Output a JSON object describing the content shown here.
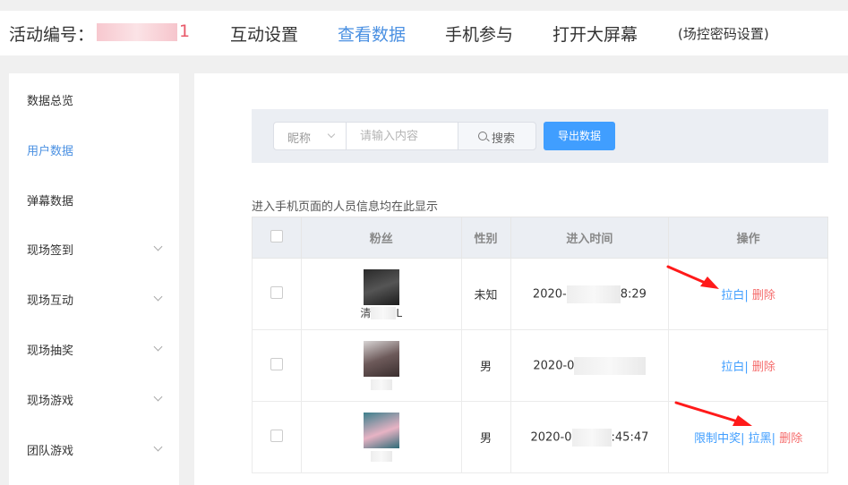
{
  "header": {
    "event_label": "活动编号：",
    "event_id_visible": "1",
    "nav": [
      {
        "label": "互动设置"
      },
      {
        "label": "查看数据"
      },
      {
        "label": "手机参与"
      },
      {
        "label": "打开大屏幕"
      },
      {
        "label": "(场控密码设置)"
      }
    ]
  },
  "sidebar": {
    "items": [
      {
        "label": "数据总览"
      },
      {
        "label": "用户数据"
      },
      {
        "label": "弹幕数据"
      },
      {
        "label": "现场签到"
      },
      {
        "label": "现场互动"
      },
      {
        "label": "现场抽奖"
      },
      {
        "label": "现场游戏"
      },
      {
        "label": "团队游戏"
      }
    ]
  },
  "filter": {
    "select_value": "昵称",
    "search_placeholder": "请输入内容",
    "search_label": "搜索",
    "export_label": "导出数据"
  },
  "hint": "进入手机页面的人员信息均在此显示",
  "table": {
    "headers": [
      "粉丝",
      "性别",
      "进入时间",
      "操作"
    ],
    "rows": [
      {
        "nickname": "清",
        "nickname_tail": "L",
        "gender": "未知",
        "time_prefix": "2020-",
        "time_suffix": "8:29",
        "actions": [
          "拉白",
          "删除"
        ]
      },
      {
        "nickname": "",
        "nickname_tail": "",
        "gender": "男",
        "time_prefix": "2020-0",
        "time_suffix": "",
        "actions": [
          "拉白",
          "删除"
        ]
      },
      {
        "nickname": "",
        "nickname_tail": "",
        "gender": "男",
        "time_prefix": "2020-0",
        "time_suffix": ":45:47",
        "actions": [
          "限制中奖",
          "拉黑",
          "删除"
        ]
      }
    ]
  },
  "colors": {
    "accent": "#409eff",
    "danger": "#f56c6c",
    "event_id": "#e85a6a",
    "annotation_arrow": "#ff1a1a"
  }
}
